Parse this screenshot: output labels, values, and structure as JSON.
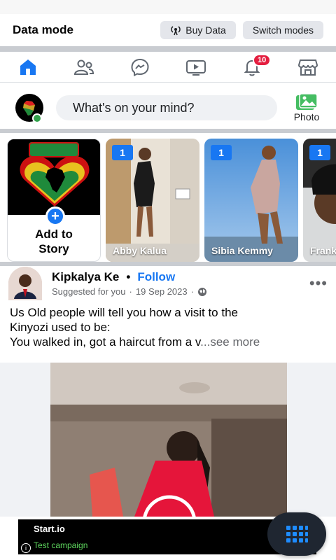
{
  "data_mode": {
    "title": "Data mode",
    "buy_data_label": "Buy Data",
    "switch_modes_label": "Switch modes"
  },
  "navbar": {
    "items": [
      {
        "icon": "home-icon",
        "active": true
      },
      {
        "icon": "friends-icon",
        "active": false
      },
      {
        "icon": "messenger-icon",
        "active": false
      },
      {
        "icon": "video-icon",
        "active": false
      },
      {
        "icon": "bell-icon",
        "active": false,
        "badge": "10"
      },
      {
        "icon": "marketplace-icon",
        "active": false
      }
    ],
    "accent": "#1877f2"
  },
  "composer": {
    "placeholder": "What's on your mind?",
    "photo_label": "Photo"
  },
  "stories": {
    "add_label_line1": "Add to",
    "add_label_line2": "Story",
    "items": [
      {
        "name": "Abby Kalua",
        "count": "1"
      },
      {
        "name": "Sibia Kemmy",
        "count": "1"
      },
      {
        "name": "Frank",
        "count": "1"
      }
    ]
  },
  "post": {
    "author": "Kipkalya Ke",
    "separator": "•",
    "follow_label": "Follow",
    "suggested": "Suggested for you",
    "date": "19 Sep 2023",
    "text_line1": "Us Old people will tell you how a visit to the",
    "text_line2": "Kinyozi used to be:",
    "text_line3": "You walked in, got a haircut from a v",
    "see_more": "...see more",
    "more_icon": "more-dots-icon"
  },
  "ad": {
    "title": "Start.io",
    "campaign": "Test campaign",
    "info": "i"
  },
  "fab": {
    "icon": "grid-menu-icon"
  }
}
